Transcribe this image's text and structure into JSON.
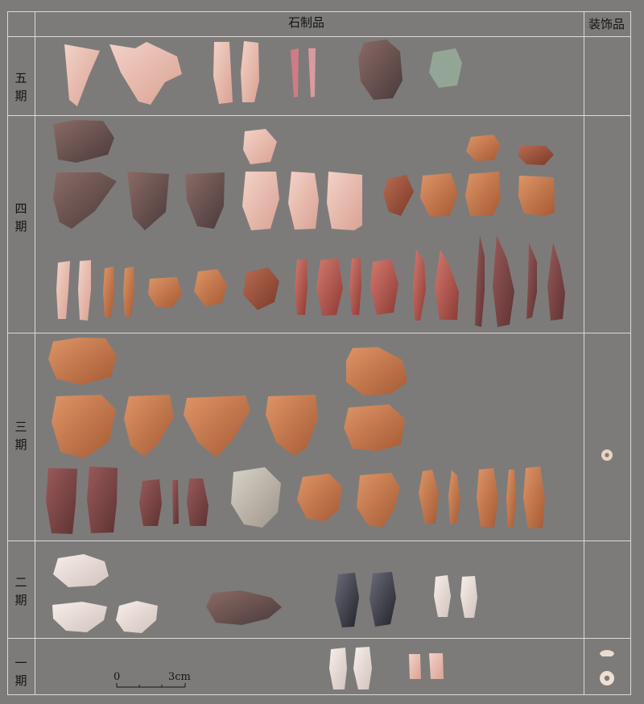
{
  "header": {
    "stone_artifacts": "石制品",
    "ornaments": "装饰品"
  },
  "periods": [
    {
      "id": "p5",
      "label": [
        "五",
        "期"
      ]
    },
    {
      "id": "p4",
      "label": [
        "四",
        "期"
      ]
    },
    {
      "id": "p3",
      "label": [
        "三",
        "期"
      ]
    },
    {
      "id": "p2",
      "label": [
        "二",
        "期"
      ]
    },
    {
      "id": "p1",
      "label": [
        "一",
        "期"
      ]
    }
  ],
  "scale_bar": {
    "start": "0",
    "end": "3cm"
  },
  "colors": {
    "background": "#7c7b7a",
    "grid_lines": "#dcdad6",
    "text": "#141414"
  }
}
